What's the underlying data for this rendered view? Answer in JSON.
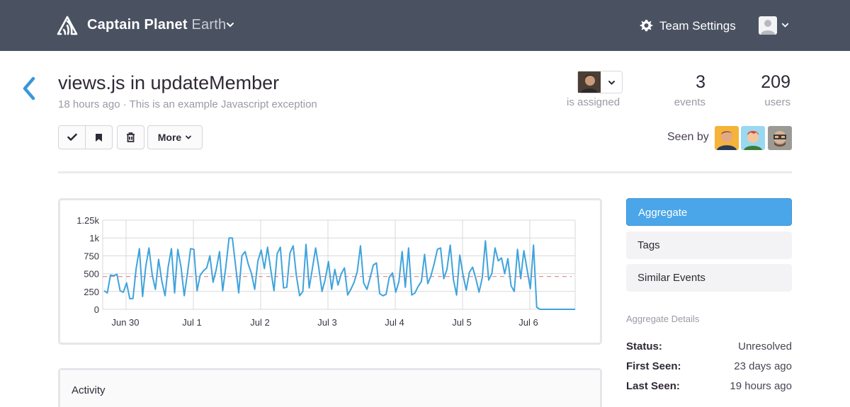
{
  "header": {
    "org_name": "Captain Planet",
    "project_name": "Earth",
    "team_settings_label": "Team Settings",
    "icons": [
      "sentry-logo-icon",
      "chevron-down-icon",
      "gear-icon",
      "user-avatar",
      "chevron-down-icon"
    ]
  },
  "issue": {
    "title": "views.js in updateMember",
    "subtitle": "18 hours ago · This is an example Javascript exception",
    "assigned_label": "is assigned",
    "events_count": "3",
    "events_label": "events",
    "users_count": "209",
    "users_label": "users",
    "more_label": "More",
    "seen_by_label": "Seen by"
  },
  "chart_data": {
    "type": "line",
    "y_ticks": [
      "1.25k",
      "1k",
      "750",
      "500",
      "250",
      "0"
    ],
    "ylim": [
      0,
      1250
    ],
    "x_ticks": [
      "Jun 30",
      "Jul 1",
      "Jul 2",
      "Jul 3",
      "Jul 4",
      "Jul 5",
      "Jul 6"
    ],
    "reference_line": 460,
    "series": [
      {
        "color": "#3fa3dc",
        "values": [
          260,
          230,
          480,
          470,
          490,
          260,
          240,
          370,
          150,
          150,
          570,
          850,
          180,
          600,
          860,
          480,
          280,
          700,
          400,
          190,
          600,
          850,
          230,
          840,
          590,
          190,
          500,
          850,
          840,
          260,
          480,
          540,
          580,
          750,
          380,
          560,
          810,
          260,
          600,
          1000,
          1000,
          620,
          230,
          750,
          810,
          630,
          500,
          280,
          680,
          830,
          570,
          870,
          560,
          260,
          780,
          870,
          300,
          310,
          790,
          890,
          470,
          190,
          250,
          910,
          300,
          570,
          860,
          580,
          250,
          420,
          670,
          280,
          560,
          340,
          500,
          580,
          200,
          280,
          380,
          530,
          890,
          370,
          280,
          440,
          620,
          650,
          220,
          190,
          210,
          450,
          510,
          240,
          390,
          810,
          310,
          860,
          200,
          230,
          320,
          390,
          770,
          360,
          470,
          640,
          840,
          860,
          430,
          560,
          900,
          420,
          200,
          760,
          480,
          270,
          520,
          590,
          430,
          240,
          440,
          960,
          410,
          500,
          860,
          680,
          720,
          500,
          710,
          330,
          250,
          840,
          430,
          820,
          560,
          290,
          900,
          30,
          0,
          0,
          0,
          0,
          0,
          0,
          0,
          0,
          0,
          0,
          0,
          0
        ]
      }
    ]
  },
  "activity": {
    "title": "Activity"
  },
  "sidebar": {
    "tabs": [
      {
        "label": "Aggregate",
        "active": true
      },
      {
        "label": "Tags",
        "active": false
      },
      {
        "label": "Similar Events",
        "active": false
      }
    ],
    "details_heading": "Aggregate Details",
    "details": [
      {
        "key": "Status:",
        "value": "Unresolved"
      },
      {
        "key": "First Seen:",
        "value": "23 days ago"
      },
      {
        "key": "Last Seen:",
        "value": "19 hours ago"
      }
    ]
  }
}
